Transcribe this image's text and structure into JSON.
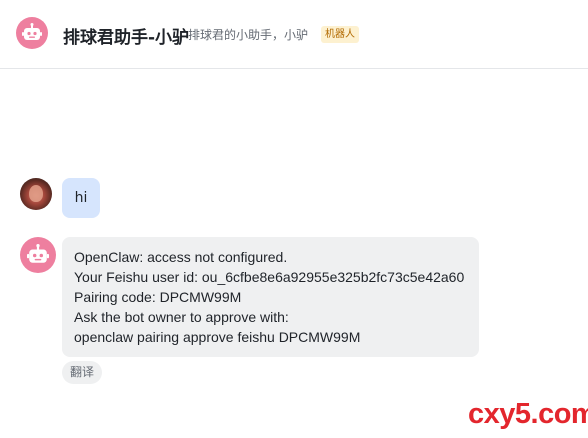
{
  "header": {
    "title": "排球君助手-小驴",
    "subtitle": "排球君的小助手，小驴",
    "badge": "机器人",
    "avatar_icon": "robot-icon"
  },
  "messages": [
    {
      "sender": "user",
      "avatar_icon": "user-photo",
      "text": "hi"
    },
    {
      "sender": "bot",
      "avatar_icon": "robot-icon",
      "lines": [
        "OpenClaw: access not configured.",
        "Your Feishu user id: ou_6cfbe8e6a92955e325b2fc73c5e42a60",
        "Pairing code: DPCMW99M",
        "Ask the bot owner to approve with:",
        "openclaw pairing approve feishu DPCMW99M"
      ],
      "action_label": "翻译"
    }
  ],
  "watermark": "cxy5.com",
  "colors": {
    "bot_avatar": "#ee7f9f",
    "user_bubble": "#d6e5fd",
    "bot_bubble": "#eff0f1",
    "badge_bg": "#fdf1d0",
    "badge_text": "#b26a00",
    "watermark": "#e3262d"
  }
}
